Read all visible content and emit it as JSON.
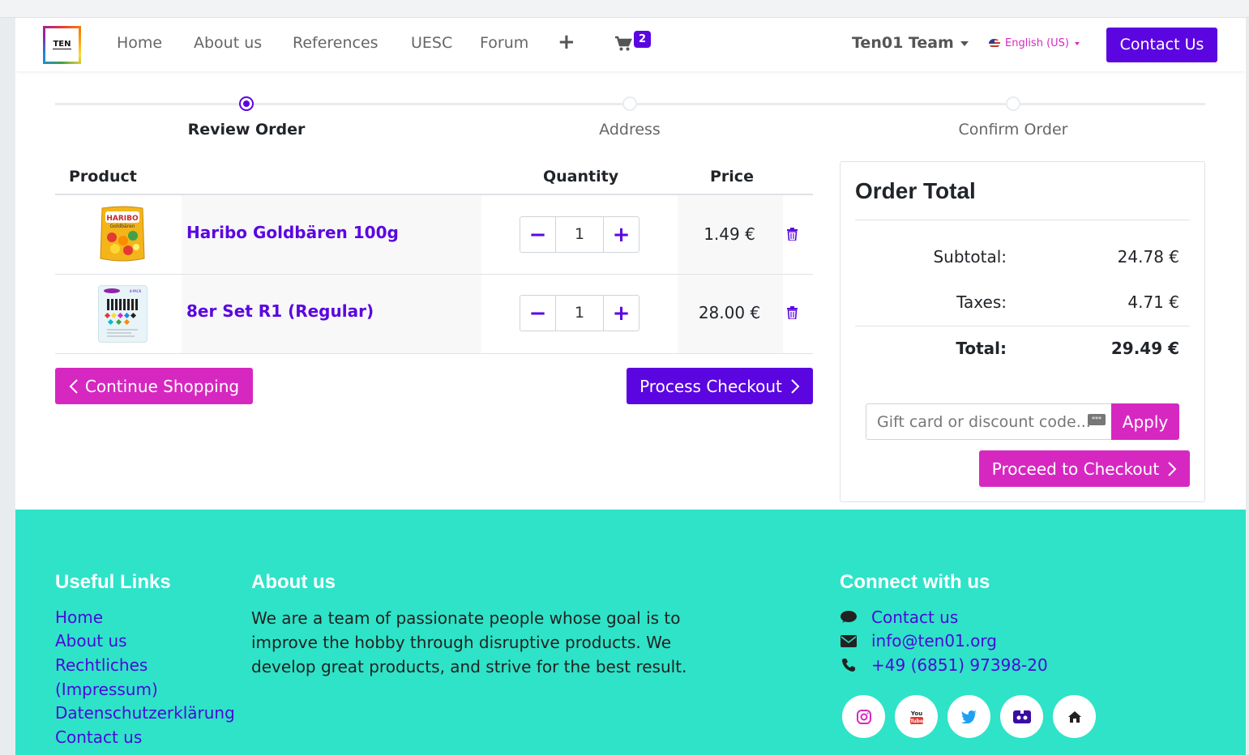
{
  "header": {
    "logo_text": "TEN",
    "nav": [
      "Home",
      "About us",
      "References",
      "UESC",
      "Forum"
    ],
    "cart_count": "2",
    "team": "Ten01 Team",
    "language": "English (US)",
    "contact_button": "Contact Us"
  },
  "steps": [
    {
      "label": "Review Order",
      "active": true
    },
    {
      "label": "Address",
      "active": false
    },
    {
      "label": "Confirm Order",
      "active": false
    }
  ],
  "cart": {
    "headers": {
      "product": "Product",
      "quantity": "Quantity",
      "price": "Price"
    },
    "items": [
      {
        "name": "Haribo Goldbären 100g",
        "quantity": "1",
        "price": "1.49 €",
        "image": "haribo-bag-icon"
      },
      {
        "name": "8er Set R1 (Regular)",
        "quantity": "1",
        "price": "28.00 €",
        "image": "paint-set-icon"
      }
    ],
    "continue_button": "Continue Shopping",
    "process_button": "Process Checkout"
  },
  "order_total": {
    "title": "Order Total",
    "subtotal_label": "Subtotal:",
    "subtotal": "24.78 €",
    "taxes_label": "Taxes:",
    "taxes": "4.71 €",
    "total_label": "Total:",
    "total": "29.49 €",
    "gift_placeholder": "Gift card or discount code...",
    "apply_button": "Apply",
    "proceed_button": "Proceed to Checkout"
  },
  "footer": {
    "useful_links_title": "Useful Links",
    "useful_links": [
      "Home",
      "About us",
      "Rechtliches",
      "(Impressum)",
      "Datenschutzerklärung",
      "Contact us"
    ],
    "about_title": "About us",
    "about_text": "We are a team of passionate people whose goal is to improve the hobby through disruptive products. We develop great products, and strive for the best result.",
    "connect_title": "Connect with us",
    "contact_label": "Contact us",
    "email": "info@ten01.org",
    "phone": "+49 (6851) 97398-20",
    "social_icons": [
      "instagram-icon",
      "youtube-icon",
      "twitter-icon",
      "discord-icon",
      "home-icon"
    ]
  },
  "colors": {
    "brand_purple": "#5b06e0",
    "brand_pink": "#d628c0",
    "footer_teal": "#2ee3c8"
  }
}
